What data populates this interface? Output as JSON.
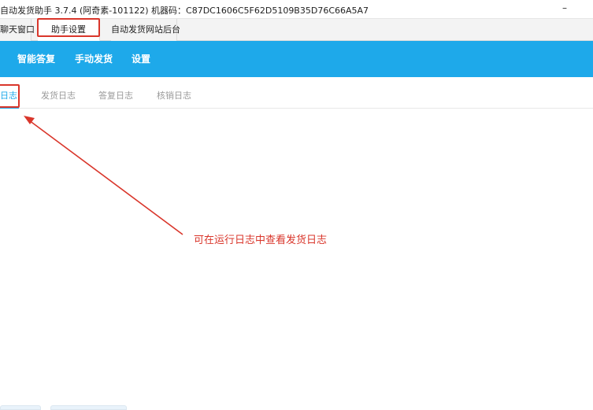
{
  "window": {
    "title": "自动发货助手 3.7.4 (阿奇素-101122) 机器码：C87DC1606C5F62D5109B35D76C66A5A7",
    "minimize_glyph": "–"
  },
  "top_tabs": [
    {
      "label": "聊天窗口"
    },
    {
      "label": "助手设置"
    },
    {
      "label": "自动发货网站后台"
    }
  ],
  "toolbar": {
    "items": [
      {
        "label": "智能答复"
      },
      {
        "label": "手动发货"
      },
      {
        "label": "设置"
      }
    ]
  },
  "sub_tabs": [
    {
      "label": "日志"
    },
    {
      "label": "发货日志"
    },
    {
      "label": "答复日志"
    },
    {
      "label": "核销日志"
    }
  ],
  "annotation": {
    "text": "可在运行日志中查看发货日志",
    "color": "#d9362b"
  },
  "colors": {
    "accent": "#1ea9ea",
    "annotation": "#d9362b"
  }
}
